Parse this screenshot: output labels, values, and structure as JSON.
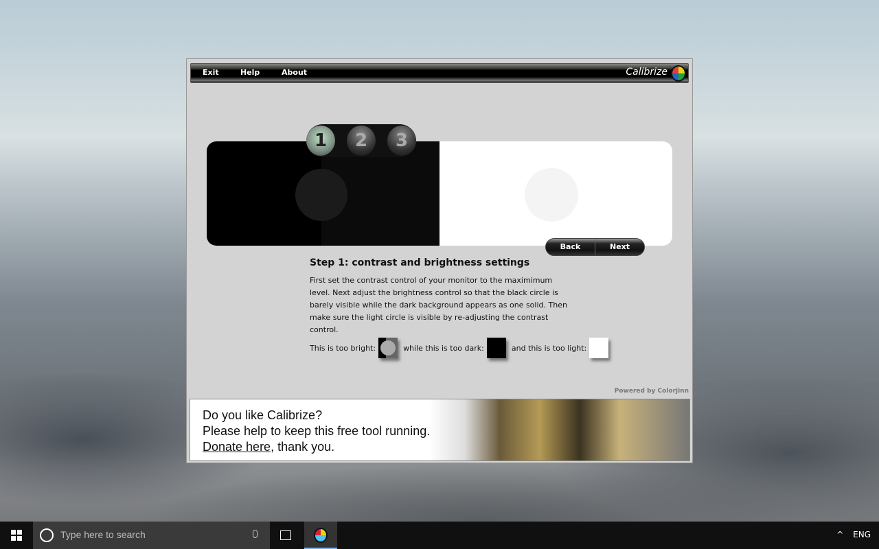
{
  "menu": {
    "items": [
      "Exit",
      "Help",
      "About"
    ],
    "brand": "Calibrize"
  },
  "steps": [
    "1",
    "2",
    "3"
  ],
  "active_step": 1,
  "nav": {
    "back": "Back",
    "next": "Next"
  },
  "content": {
    "title": "Step 1: contrast and brightness settings",
    "description": "First set the contrast control of your monitor to the maximimum level. Next adjust the brightness control so that the black circle is barely visible while the dark background appears as one solid. Then make sure the light circle is visible by re-adjusting the contrast control.",
    "too_bright": "This is too bright:",
    "too_dark": "while this is too dark:",
    "too_light": "and this is too light:"
  },
  "powered_by": "Powered by Colorjinn",
  "banner": {
    "line1": "Do you like Calibrize?",
    "line2": "Please help to keep this free tool running.",
    "link": "Donate here",
    "line3_rest": ", thank you."
  },
  "taskbar": {
    "search_placeholder": "Type here to search",
    "language": "ENG"
  }
}
